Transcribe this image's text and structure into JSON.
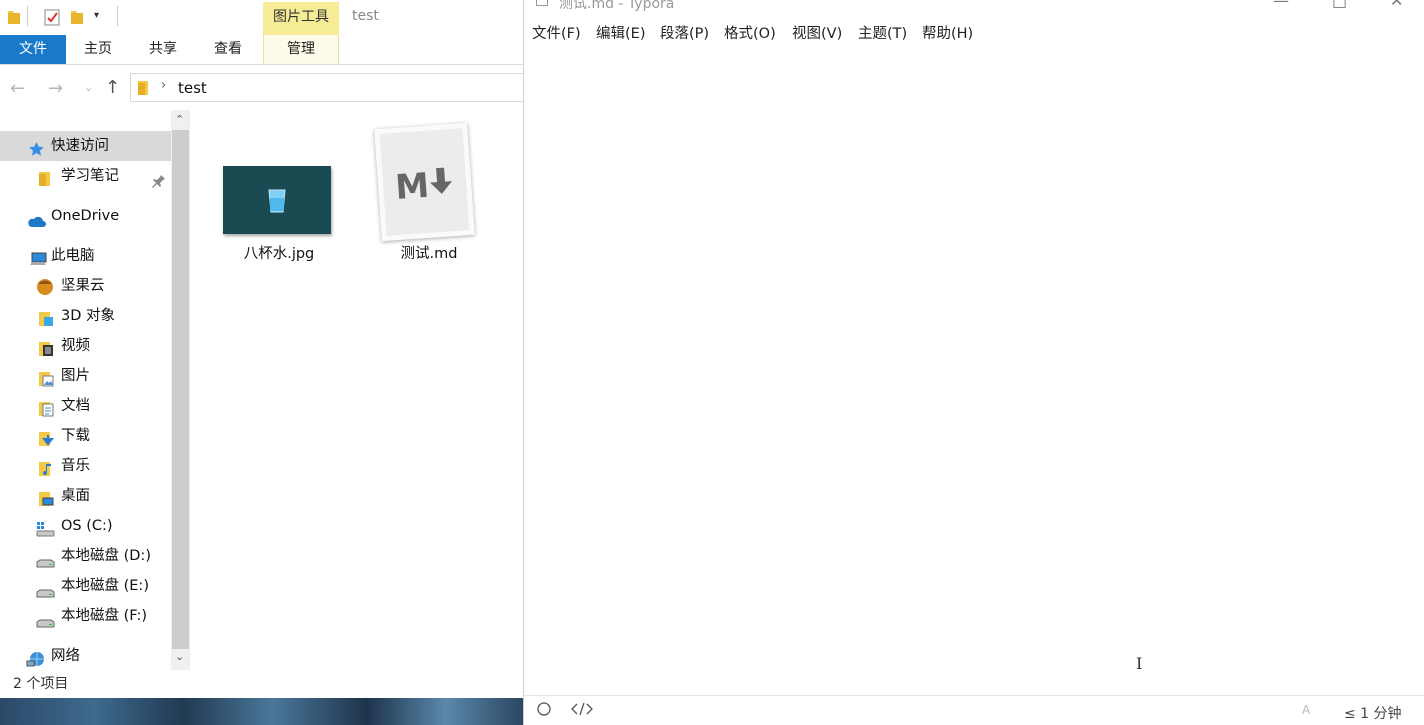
{
  "explorer": {
    "contextual_tab_group": "图片工具",
    "window_title": "test",
    "ribbon_tabs": [
      {
        "label": "文件"
      },
      {
        "label": "主页"
      },
      {
        "label": "共享"
      },
      {
        "label": "查看"
      },
      {
        "label": "管理"
      }
    ],
    "address": {
      "crumb": "test"
    },
    "nav_items": [
      {
        "label": "快速访问",
        "icon": "star-icon",
        "selected": true
      },
      {
        "label": "学习笔记",
        "icon": "folder-icon",
        "pinned": true
      },
      {
        "label": "OneDrive",
        "icon": "cloud-icon"
      },
      {
        "label": "此电脑",
        "icon": "computer-icon"
      },
      {
        "label": "坚果云",
        "icon": "nut-icon"
      },
      {
        "label": "3D 对象",
        "icon": "objects-3d-icon"
      },
      {
        "label": "视频",
        "icon": "video-icon"
      },
      {
        "label": "图片",
        "icon": "pictures-icon"
      },
      {
        "label": "文档",
        "icon": "documents-icon"
      },
      {
        "label": "下载",
        "icon": "download-icon"
      },
      {
        "label": "音乐",
        "icon": "music-icon"
      },
      {
        "label": "桌面",
        "icon": "desktop-icon"
      },
      {
        "label": "OS (C:)",
        "icon": "windows-drive-icon"
      },
      {
        "label": "本地磁盘 (D:)",
        "icon": "drive-icon"
      },
      {
        "label": "本地磁盘 (E:)",
        "icon": "drive-icon"
      },
      {
        "label": "本地磁盘 (F:)",
        "icon": "drive-icon"
      },
      {
        "label": "网络",
        "icon": "network-icon"
      }
    ],
    "files": [
      {
        "name": "八杯水.jpg",
        "icon": "image-thumbnail"
      },
      {
        "name": "测试.md",
        "icon": "markdown-icon"
      }
    ],
    "status": "2 个项目",
    "colors": {
      "accent": "#1979ca",
      "contextual": "#f6ec95",
      "selected": "#d9d9d9"
    }
  },
  "typora": {
    "title": "测试.md - Typora",
    "menus": [
      "文件(F)",
      "编辑(E)",
      "段落(P)",
      "格式(O)",
      "视图(V)",
      "主题(T)",
      "帮助(H)"
    ],
    "footer": {
      "word_count": "≤ 1 分钟",
      "spellcheck_mark": "A"
    }
  }
}
